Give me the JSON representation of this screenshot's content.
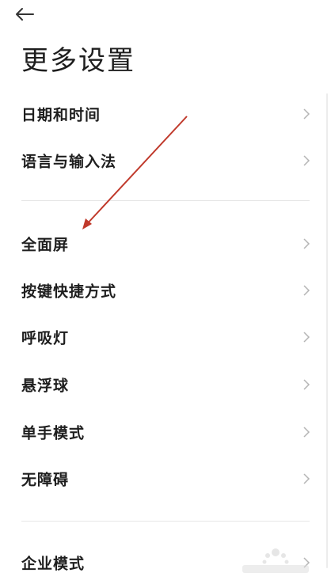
{
  "header": {
    "back_icon": "arrow-left-icon",
    "title": "更多设置"
  },
  "settings": {
    "group1": [
      {
        "label": "日期和时间"
      },
      {
        "label": "语言与输入法"
      }
    ],
    "group2": [
      {
        "label": "全面屏"
      },
      {
        "label": "按键快捷方式"
      },
      {
        "label": "呼吸灯"
      },
      {
        "label": "悬浮球"
      },
      {
        "label": "单手模式"
      },
      {
        "label": "无障碍"
      }
    ],
    "group3": [
      {
        "label": "企业模式"
      }
    ]
  },
  "icons": {
    "chevron": "chevron-right-icon"
  },
  "colors": {
    "annotation_arrow": "#c0392b",
    "chevron": "#b5b5b5",
    "divider": "#e6e6e6"
  }
}
